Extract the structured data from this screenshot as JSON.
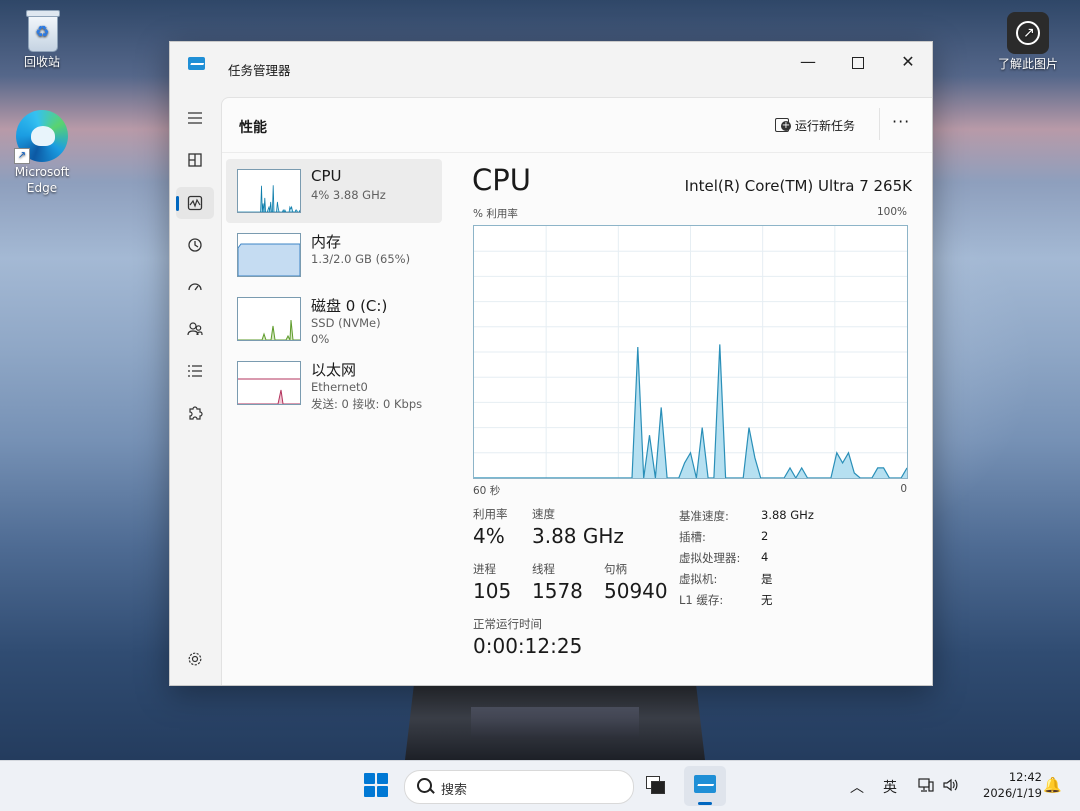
{
  "desktop": {
    "icons": [
      {
        "label": "回收站"
      },
      {
        "label": "Microsoft Edge"
      },
      {
        "label": "了解此图片"
      }
    ]
  },
  "window": {
    "title": "任务管理器",
    "controls": {
      "minimize": "—",
      "maximize": "",
      "close": "✕"
    }
  },
  "page": {
    "title": "性能",
    "run_new_task": "运行新任务",
    "more": "···"
  },
  "resources": [
    {
      "name": "CPU",
      "sub1": "4% 3.88 GHz",
      "sub2": "",
      "color": "#0d7dab"
    },
    {
      "name": "内存",
      "sub1": "1.3/2.0 GB (65%)",
      "sub2": "",
      "color": "#3d84c6"
    },
    {
      "name": "磁盘 0 (C:)",
      "sub1": "SSD (NVMe)",
      "sub2": "0%",
      "color": "#5e9b2b"
    },
    {
      "name": "以太网",
      "sub1": "Ethernet0",
      "sub2": "发送: 0 接收: 0 Kbps",
      "color": "#b3335d"
    }
  ],
  "cpu": {
    "title": "CPU",
    "model": "Intel(R) Core(TM) Ultra 7 265K",
    "graph_label_left": "% 利用率",
    "graph_label_right": "100%",
    "graph_label_bottom_left": "60 秒",
    "graph_label_bottom_right": "0",
    "graph_color": "#2a8fb8",
    "graph_fill": "#b6e0f1",
    "usage_history": [
      0,
      0,
      0,
      0,
      0,
      0,
      0,
      0,
      0,
      0,
      0,
      0,
      0,
      0,
      0,
      0,
      0,
      0,
      0,
      0,
      0,
      0,
      0,
      0,
      0,
      0,
      0,
      0,
      52,
      0,
      17,
      0,
      28,
      0,
      0,
      0,
      6,
      10,
      0,
      20,
      0,
      0,
      53,
      0,
      0,
      0,
      0,
      20,
      8,
      0,
      0,
      0,
      0,
      0,
      4,
      0,
      4,
      0,
      0,
      0,
      0,
      0,
      10,
      6,
      10,
      2,
      0,
      0,
      0,
      4,
      4,
      0,
      0,
      0,
      4
    ],
    "stats": {
      "utilization_label": "利用率",
      "utilization": "4%",
      "speed_label": "速度",
      "speed": "3.88 GHz",
      "processes_label": "进程",
      "processes": "105",
      "threads_label": "线程",
      "threads": "1578",
      "handles_label": "句柄",
      "handles": "50940",
      "uptime_label": "正常运行时间",
      "uptime": "0:00:12:25"
    },
    "details": [
      {
        "key": "基准速度:",
        "value": "3.88 GHz"
      },
      {
        "key": "插槽:",
        "value": "2"
      },
      {
        "key": "虚拟处理器:",
        "value": "4"
      },
      {
        "key": "虚拟机:",
        "value": "是"
      },
      {
        "key": "L1 缓存:",
        "value": "无"
      }
    ]
  },
  "taskbar": {
    "search_placeholder": "搜索",
    "ime": "英",
    "time": "12:42",
    "date": "2026/1/19"
  }
}
